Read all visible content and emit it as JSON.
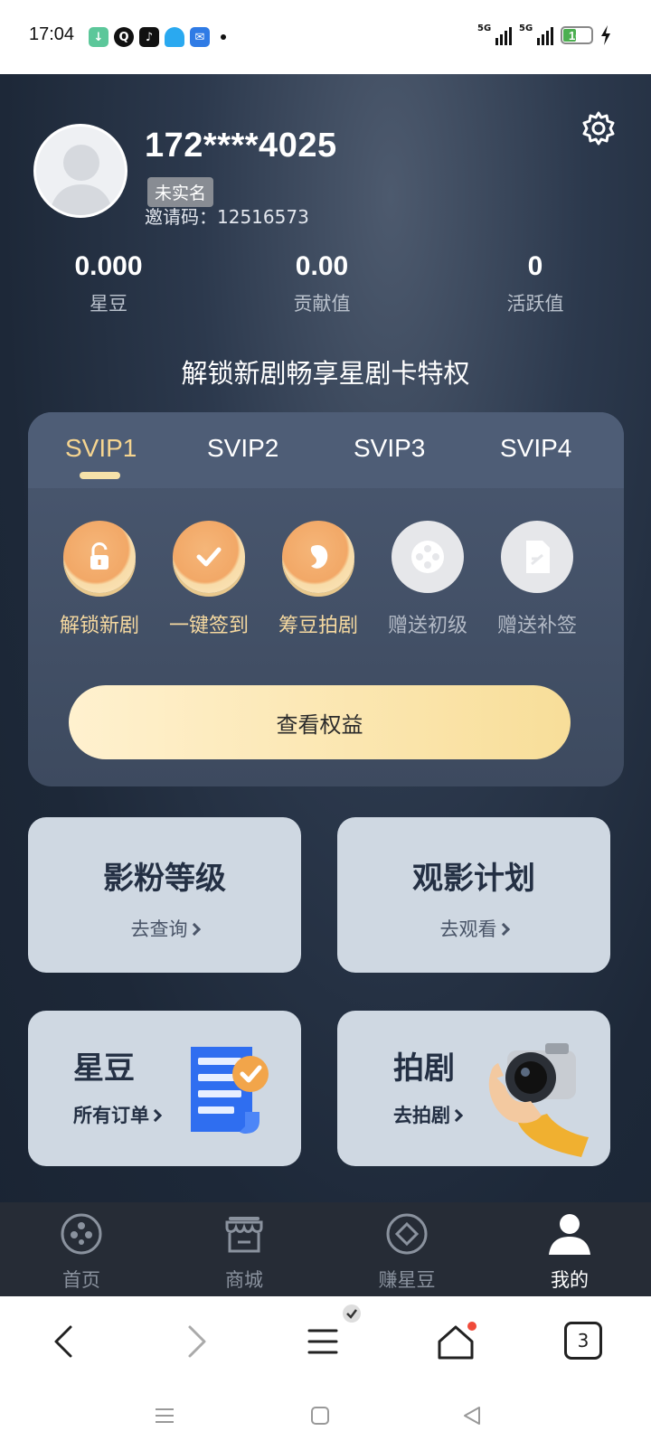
{
  "status_bar": {
    "time": "17:04",
    "notification_icons": [
      "download-icon",
      "q-icon",
      "tiktok-icon",
      "qq-icon",
      "mail-icon"
    ],
    "network_1": "5G",
    "network_2": "5G",
    "battery": "16"
  },
  "profile": {
    "phone": "172****4025",
    "verification_badge": "未实名",
    "invite_code": "邀请码：12516573"
  },
  "stats": [
    {
      "value": "0.000",
      "label": "星豆"
    },
    {
      "value": "0.00",
      "label": "贡献值"
    },
    {
      "value": "0",
      "label": "活跃值"
    }
  ],
  "vip": {
    "headline": "解锁新剧畅享星剧卡特权",
    "tabs": [
      "SVIP1",
      "SVIP2",
      "SVIP3",
      "SVIP4"
    ],
    "active_tab": "SVIP1",
    "perks": [
      {
        "label": "解锁新剧",
        "icon": "lock-icon",
        "enabled": true
      },
      {
        "label": "一键签到",
        "icon": "check-icon",
        "enabled": true
      },
      {
        "label": "筹豆拍剧",
        "icon": "bean-icon",
        "enabled": true
      },
      {
        "label": "赠送初级",
        "icon": "film-reel-icon",
        "enabled": false
      },
      {
        "label": "赠送补签",
        "icon": "document-icon",
        "enabled": false
      }
    ],
    "cta_label": "查看权益"
  },
  "tiles": {
    "fan_level": {
      "title": "影粉等级",
      "link": "去查询"
    },
    "watch_plan": {
      "title": "观影计划",
      "link": "去观看"
    },
    "star_bean": {
      "title": "星豆",
      "link": "所有订单"
    },
    "shoot": {
      "title": "拍剧",
      "link": "去拍剧"
    }
  },
  "tabbar": [
    {
      "label": "首页",
      "icon": "film-reel-icon"
    },
    {
      "label": "商城",
      "icon": "store-icon"
    },
    {
      "label": "赚星豆",
      "icon": "diamond-icon"
    },
    {
      "label": "我的",
      "icon": "user-icon"
    }
  ],
  "active_tab": "我的",
  "browser": {
    "tab_count": "3"
  },
  "colors": {
    "accent_gold": "#f6d590",
    "background_dark": "#1d2838",
    "tile_bg": "#cfd8e2",
    "tabbar_bg": "#262c36"
  }
}
